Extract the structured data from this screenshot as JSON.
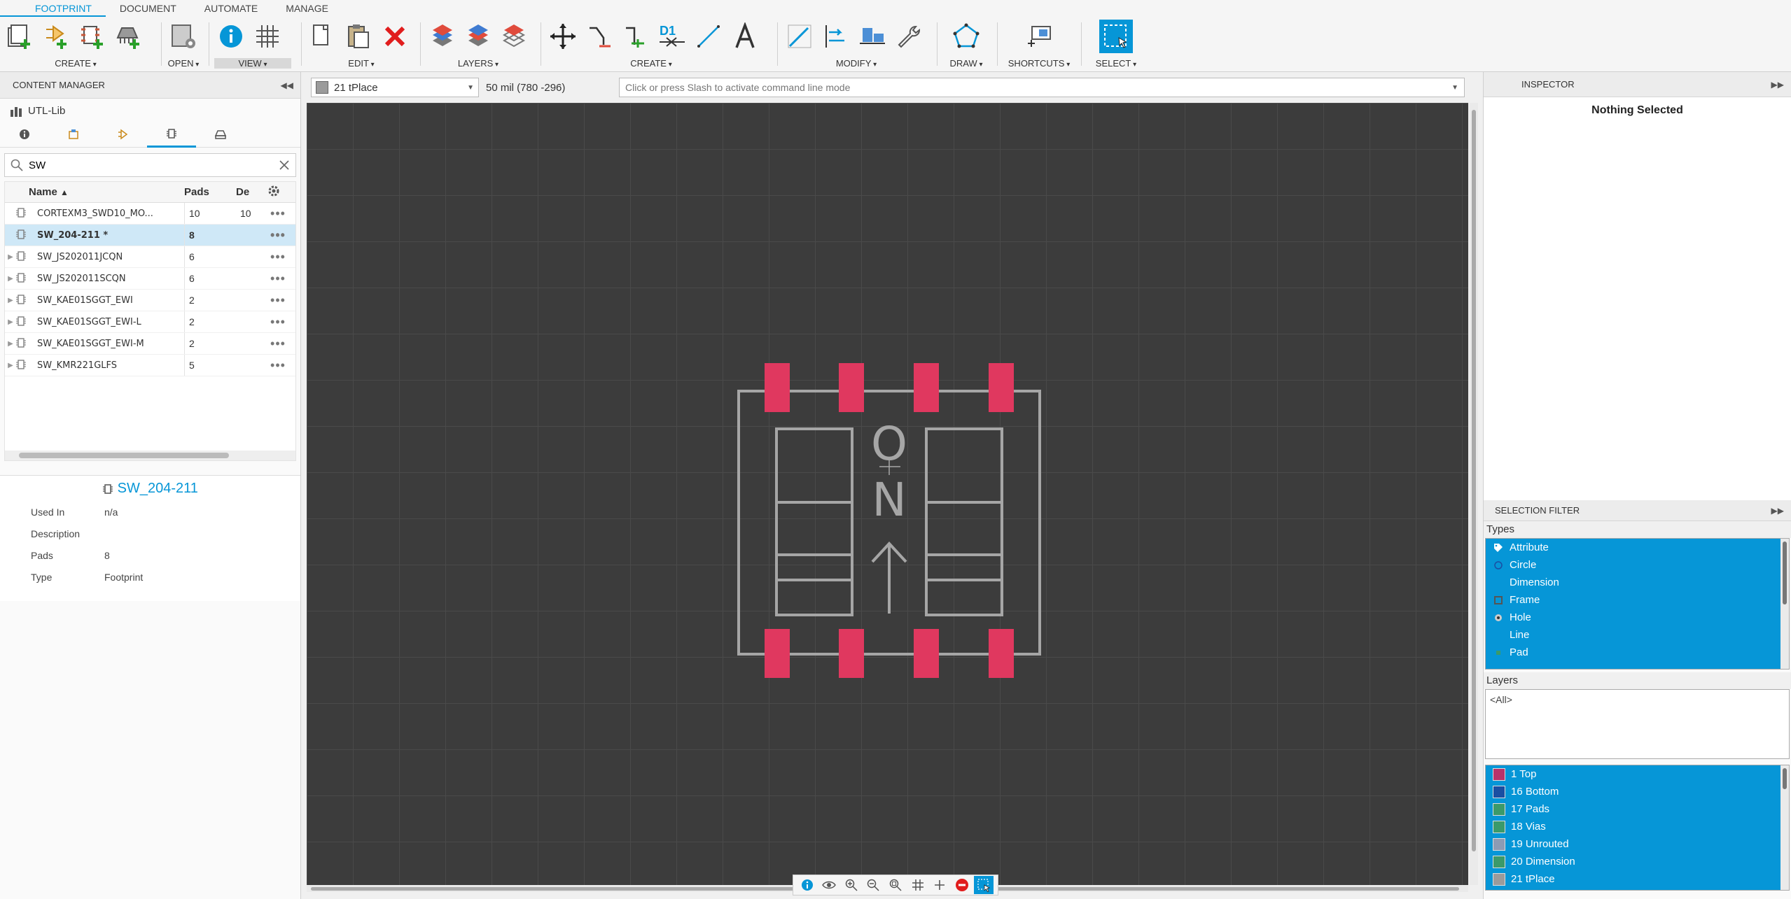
{
  "ribbon": {
    "tabs": [
      "FOOTPRINT",
      "DOCUMENT",
      "AUTOMATE",
      "MANAGE"
    ],
    "groups": {
      "create": "CREATE",
      "open": "OPEN",
      "view": "VIEW",
      "edit": "EDIT",
      "layers": "LAYERS",
      "create2": "CREATE",
      "modify": "MODIFY",
      "draw": "DRAW",
      "shortcuts": "SHORTCUTS",
      "select": "SELECT"
    },
    "d1_label": "D1"
  },
  "content_manager": {
    "title": "CONTENT MANAGER",
    "library": "UTL-Lib",
    "search": {
      "value": "SW",
      "placeholder": ""
    },
    "columns": {
      "name": "Name",
      "pads": "Pads",
      "de": "De"
    },
    "rows": [
      {
        "name": "CORTEXM3_SWD10_MO...",
        "pads": "10",
        "de": "10",
        "selected": false
      },
      {
        "name": "SW_204-211 *",
        "pads": "8",
        "de": "",
        "selected": true
      },
      {
        "name": "SW_JS202011JCQN",
        "pads": "6",
        "de": "",
        "selected": false
      },
      {
        "name": "SW_JS202011SCQN",
        "pads": "6",
        "de": "",
        "selected": false
      },
      {
        "name": "SW_KAE01SGGT_EWI",
        "pads": "2",
        "de": "",
        "selected": false
      },
      {
        "name": "SW_KAE01SGGT_EWI-L",
        "pads": "2",
        "de": "",
        "selected": false
      },
      {
        "name": "SW_KAE01SGGT_EWI-M",
        "pads": "2",
        "de": "",
        "selected": false
      },
      {
        "name": "SW_KMR221GLFS",
        "pads": "5",
        "de": "",
        "selected": false
      }
    ],
    "details": {
      "title": "SW_204-211",
      "used_in_label": "Used In",
      "used_in": "n/a",
      "description_label": "Description",
      "description": "",
      "pads_label": "Pads",
      "pads": "8",
      "type_label": "Type",
      "type": "Footprint"
    }
  },
  "canvas_bar": {
    "layer": "21 tPlace",
    "coords": "50 mil (780 -296)",
    "command_placeholder": "Click or press Slash to activate command line mode"
  },
  "footprint": {
    "silkscreen_text_top": "O",
    "silkscreen_text_bottom": "N"
  },
  "inspector": {
    "title": "INSPECTOR",
    "empty_text": "Nothing Selected"
  },
  "selection_filter": {
    "title": "SELECTION FILTER",
    "types_label": "Types",
    "types": [
      "Attribute",
      "Circle",
      "Dimension",
      "Frame",
      "Hole",
      "Line",
      "Pad"
    ],
    "layers_label": "Layers",
    "layers_value": "<All>",
    "layers": [
      {
        "name": "1 Top",
        "color": "#b8336a"
      },
      {
        "name": "16 Bottom",
        "color": "#1a4fa3"
      },
      {
        "name": "17 Pads",
        "color": "#3b9a6a"
      },
      {
        "name": "18 Vias",
        "color": "#3b9a6a"
      },
      {
        "name": "19 Unrouted",
        "color": "#8c9bb4"
      },
      {
        "name": "20 Dimension",
        "color": "#3b9a6a"
      },
      {
        "name": "21 tPlace",
        "color": "#9b9b9b"
      }
    ]
  },
  "colors": {
    "accent": "#0696d7",
    "canvas": "#3c3c3c",
    "pad": "#e0385f",
    "silk": "#a6a6a6"
  }
}
